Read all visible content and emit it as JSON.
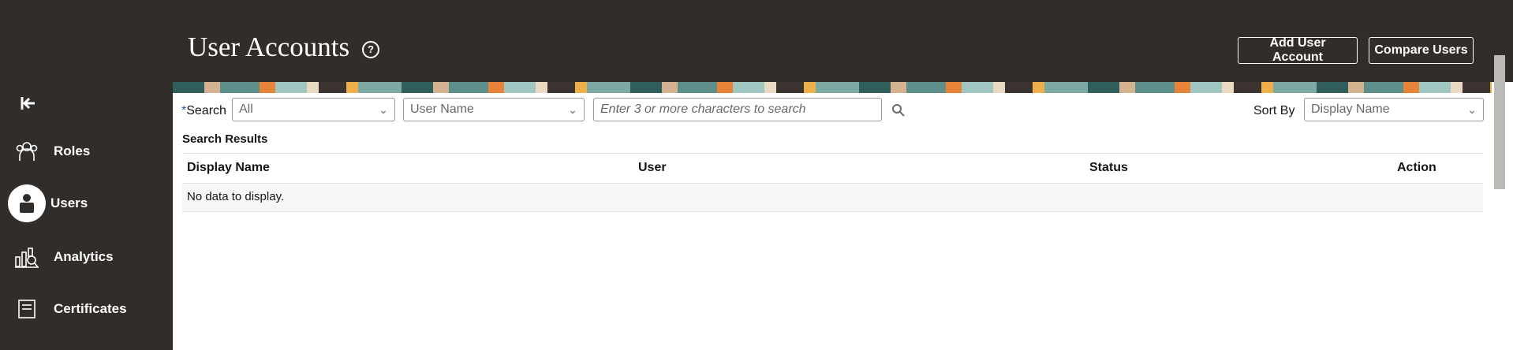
{
  "header": {
    "title": "User Accounts",
    "buttons": {
      "add_user": "Add User Account",
      "compare_users": "Compare Users"
    }
  },
  "sidebar": {
    "items": [
      {
        "label": "Roles",
        "icon": "roles-icon"
      },
      {
        "label": "Users",
        "icon": "user-icon",
        "active": true
      },
      {
        "label": "Analytics",
        "icon": "analytics-icon"
      },
      {
        "label": "Certificates",
        "icon": "certificate-icon"
      }
    ]
  },
  "search": {
    "label": "Search",
    "required_mark": "*",
    "scope": "All",
    "field": "User Name",
    "placeholder": "Enter 3 or more characters to search"
  },
  "sort": {
    "label": "Sort By",
    "value": "Display Name"
  },
  "results": {
    "title": "Search Results",
    "columns": [
      "Display Name",
      "User",
      "Status",
      "Action"
    ],
    "empty_text": "No data to display."
  },
  "colors": {
    "header_bg": "#312d2a",
    "required": "#2a5aa9",
    "empty_row_bg": "#f6f7f9"
  }
}
